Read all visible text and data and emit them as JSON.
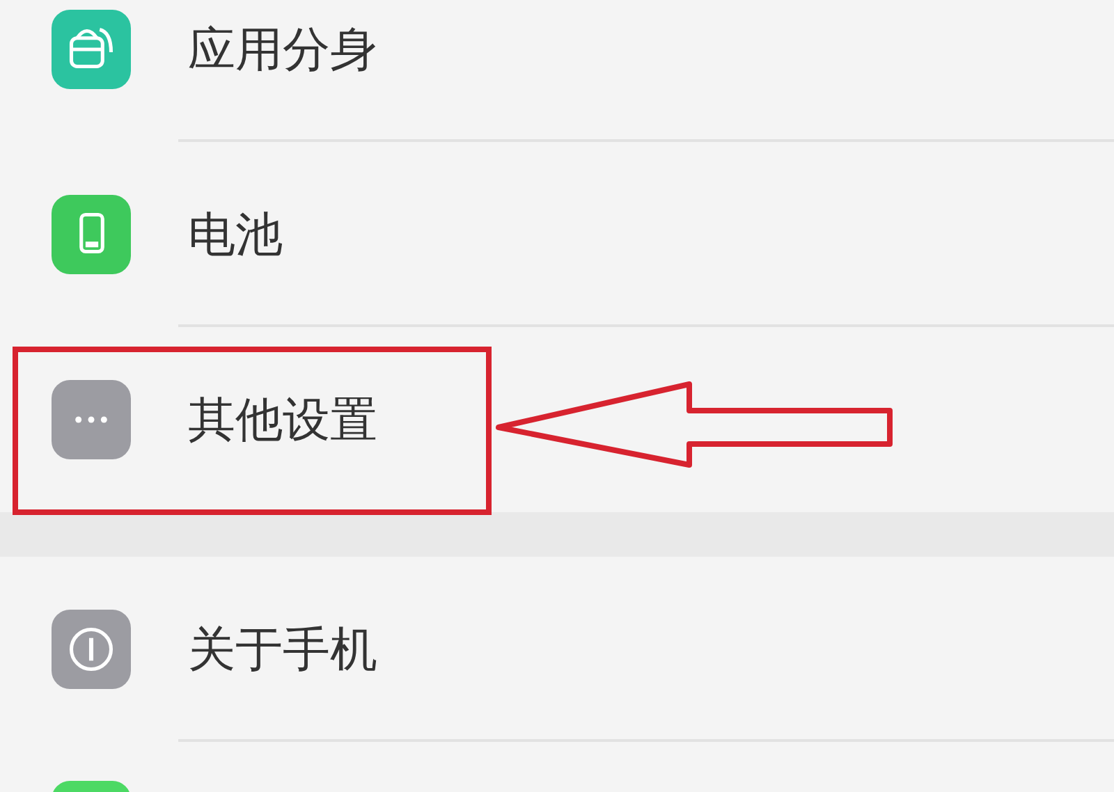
{
  "sections": [
    {
      "items": [
        {
          "label": "应用分身",
          "kind": "clone",
          "color": "#2bc3a0",
          "highlighted": false
        },
        {
          "label": "电池",
          "kind": "battery",
          "color": "#3ec95c",
          "highlighted": false
        },
        {
          "label": "其他设置",
          "kind": "more",
          "color": "#9c9ca2",
          "highlighted": true
        }
      ]
    },
    {
      "items": [
        {
          "label": "关于手机",
          "kind": "info",
          "color": "#9c9ca2",
          "highlighted": false
        },
        {
          "kind": "cut",
          "color": "#4cd964",
          "highlighted": false
        }
      ]
    }
  ]
}
